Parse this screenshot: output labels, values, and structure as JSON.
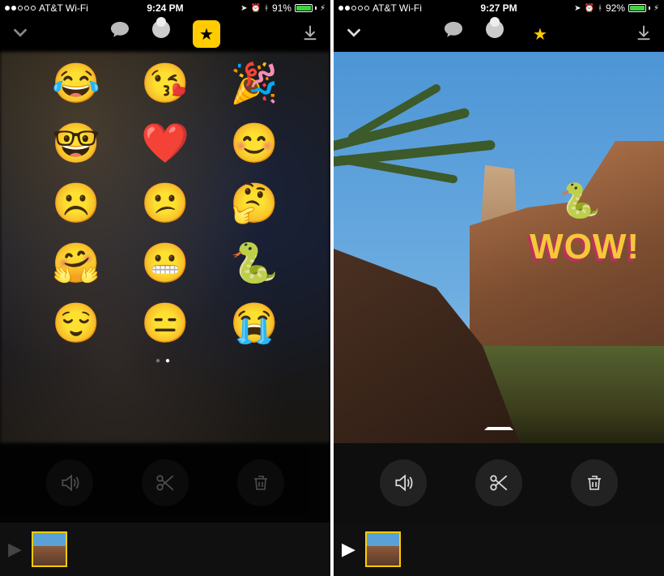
{
  "left": {
    "status": {
      "carrier": "AT&T Wi-Fi",
      "time": "9:24 PM",
      "battery_pct": "91%",
      "battery_fill_pct": 91
    },
    "toolbar": {
      "collapse_icon": "chevron-down-icon",
      "speech_icon": "speech-bubble-icon",
      "filters_icon": "filters-icon",
      "stickers_icon": "star-icon",
      "stickers_active": true,
      "download_icon": "download-icon"
    },
    "stickers": [
      "😂",
      "😘",
      "🎉",
      "🤓",
      "❤️",
      "😊",
      "☹️",
      "😕",
      "🤔",
      "🤗",
      "😬",
      "🐍",
      "😌",
      "😑",
      "😭"
    ],
    "page_dots": {
      "count": 2,
      "active": 1
    },
    "controls": {
      "mute": "volume-icon",
      "cut": "scissors-icon",
      "delete": "trash-icon"
    },
    "timeline": {
      "play": "play-icon"
    }
  },
  "right": {
    "status": {
      "carrier": "AT&T Wi-Fi",
      "time": "9:27 PM",
      "battery_pct": "92%",
      "battery_fill_pct": 92
    },
    "toolbar": {
      "collapse_icon": "chevron-down-icon",
      "speech_icon": "speech-bubble-icon",
      "filters_icon": "filters-icon",
      "stickers_icon": "star-icon",
      "stickers_active": true,
      "download_icon": "download-icon"
    },
    "overlay": {
      "snake": "🐍",
      "wow_text": "WOW!"
    },
    "controls": {
      "mute": "volume-icon",
      "cut": "scissors-icon",
      "delete": "trash-icon"
    },
    "timeline": {
      "play": "play-icon"
    }
  }
}
